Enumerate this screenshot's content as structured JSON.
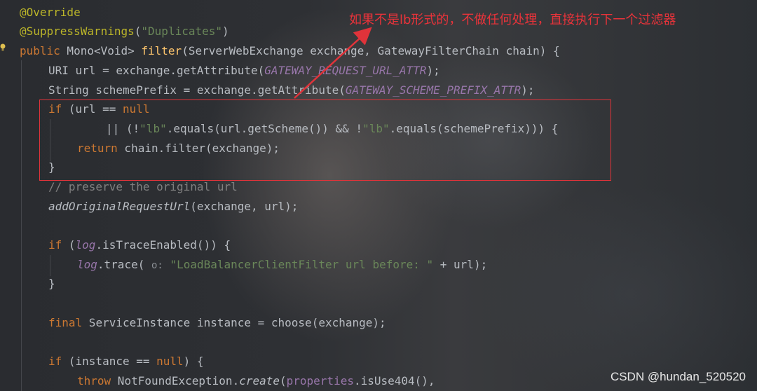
{
  "annotation": {
    "text": "如果不是lb形式的，不做任何处理，直接执行下一个过滤器",
    "color": "#e8333a"
  },
  "watermark": "CSDN @hundan_520520",
  "editor_theme": {
    "background": "#22262b",
    "keyword": "#cc7832",
    "annotation": "#bbb529",
    "string": "#6a8759",
    "method": "#ffc66d",
    "constant": "#9876aa",
    "comment": "#808080"
  },
  "code": {
    "l1": "@Override",
    "l2_ann": "@SuppressWarnings",
    "l2_open": "(",
    "l2_str": "\"Duplicates\"",
    "l2_close": ")",
    "l3_kw": "public",
    "l3_type": " Mono<Void> ",
    "l3_fn": "filter",
    "l3_args": "(ServerWebExchange exchange, GatewayFilterChain chain) {",
    "l4_a": "URI url = exchange.getAttribute(",
    "l4_const": "GATEWAY_REQUEST_URL_ATTR",
    "l4_b": ");",
    "l5_a": "String schemePrefix = exchange.getAttribute(",
    "l5_const": "GATEWAY_SCHEME_PREFIX_ATTR",
    "l5_b": ");",
    "l6_kw": "if",
    "l6_a": " (url == ",
    "l6_kw2": "null",
    "l7_a": "|| (!",
    "l7_str1": "\"lb\"",
    "l7_b": ".equals(url.getScheme()) && !",
    "l7_str2": "\"lb\"",
    "l7_c": ".equals(schemePrefix))) {",
    "l8_kw": "return",
    "l8_a": " chain.filter(exchange);",
    "l9": "}",
    "l10": "// preserve the original url",
    "l11_fn": "addOriginalRequestUrl",
    "l11_a": "(exchange, url);",
    "l12_kw": "if",
    "l12_a": " (",
    "l12_fld": "log",
    "l12_b": ".isTraceEnabled()) {",
    "l13_fld": "log",
    "l13_a": ".trace( ",
    "l13_hint": "o:",
    "l13_str": " \"LoadBalancerClientFilter url before: \"",
    "l13_b": " + url);",
    "l14": "}",
    "l15_kw": "final",
    "l15_a": " ServiceInstance instance = choose(exchange);",
    "l16_kw": "if",
    "l16_a": " (instance == ",
    "l16_kw2": "null",
    "l16_b": ") {",
    "l17_kw": "throw",
    "l17_a": " NotFoundException.",
    "l17_fn": "create",
    "l17_b": "(",
    "l17_fld": "properties",
    "l17_c": ".isUse404(),"
  }
}
